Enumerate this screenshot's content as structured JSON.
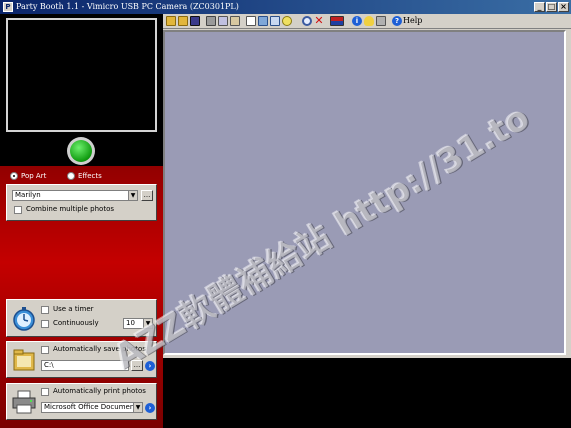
{
  "window": {
    "title": "Party Booth 1.1 - Vimicro USB PC Camera (ZC0301PL)",
    "minimize_glyph": "_",
    "maximize_glyph": "□",
    "close_glyph": "×"
  },
  "modes": {
    "popart_label": "Pop Art",
    "effects_label": "Effects",
    "selected": "Pop Art"
  },
  "popart": {
    "style_value": "Marilyn",
    "browse_label": "...",
    "combine_label": "Combine multiple photos",
    "combine_checked": false
  },
  "timer": {
    "use_timer_label": "Use a timer",
    "continuously_label": "Continuously",
    "timer_value": "10"
  },
  "save": {
    "auto_save_label": "Automatically save photos",
    "path_value": "C:\\",
    "browse_label": "..."
  },
  "print": {
    "auto_print_label": "Automatically print photos",
    "printer_value": "Microsoft Office Document Image"
  },
  "toolbar": {
    "help_label": "Help",
    "icons": [
      "open-folder-icon",
      "folder-icon",
      "save-icon",
      "print-icon",
      "copy-icon",
      "clipboard-icon",
      "new-page-icon",
      "photo-icon",
      "frame-icon",
      "adjust-icon",
      "zoom-icon",
      "delete-icon",
      "flag-icon",
      "info-icon",
      "bulb-icon",
      "tools-icon",
      "help-icon"
    ]
  },
  "watermark": {
    "text": "AZZ軟體補給站 http://31.to"
  },
  "colors": {
    "titlebar_start": "#0a246a",
    "titlebar_end": "#3a6ea5",
    "panel_red": "#c40000",
    "canvas": "#9a9bb5",
    "capture_green": "#0f9a0f"
  }
}
